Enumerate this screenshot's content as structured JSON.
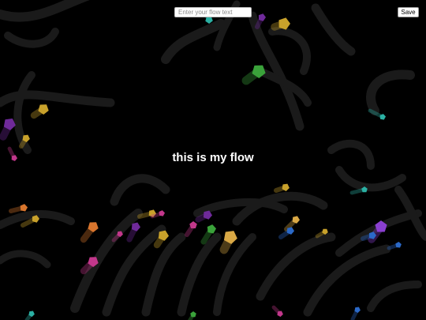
{
  "input": {
    "placeholder": "Enter your flow text",
    "value": ""
  },
  "save_button": {
    "label": "Save"
  },
  "flow_text": "this is my flow",
  "colors": {
    "background": "#000000",
    "trail": "#1a1a1a",
    "text": "#ffffff",
    "particles": [
      "#6f2a9a",
      "#c8a12b",
      "#3aa23a",
      "#c2378b",
      "#d9a845",
      "#2b69c8",
      "#2bb0a3",
      "#d8752d",
      "#8a3fd0",
      "#e23a3a"
    ]
  }
}
